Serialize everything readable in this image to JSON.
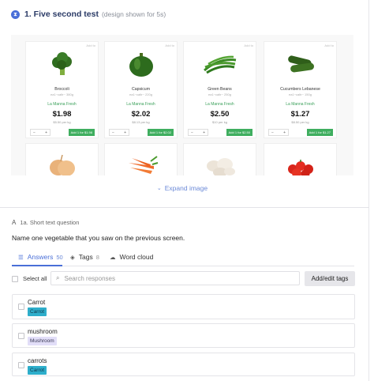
{
  "header": {
    "icon": "hourglass-icon",
    "title": "1. Five second test",
    "subtitle": "(design shown for 5s)"
  },
  "preview": {
    "products": [
      {
        "name": "Broccoli",
        "sub": "ea1~caltr~ 380g",
        "brand": "La Manna Fresh",
        "price": "$1.98",
        "unit": "$5.50 per kg",
        "add": "Add 1 for $1.98",
        "tag": "Add to"
      },
      {
        "name": "Capsicum",
        "sub": "ea1~caltr~ 220g",
        "brand": "La Manna Fresh",
        "price": "$2.02",
        "unit": "$8.13 per kg",
        "add": "Add 1 for $2.02",
        "tag": "Add to"
      },
      {
        "name": "Green Beans",
        "sub": "ea1~caltr~ 250g",
        "brand": "La Manna Fresh",
        "price": "$2.50",
        "unit": "$10 per kg",
        "add": "Add 1 for $2.50",
        "tag": "Add to"
      },
      {
        "name": "Cucumbers Lebanese",
        "sub": "ea1~caltr~ 150g",
        "brand": "La Manna Fresh",
        "price": "$1.27",
        "unit": "$8.50 per kg",
        "add": "Add 1 for $1.27",
        "tag": "Add to"
      }
    ],
    "expand_label": "Expand image"
  },
  "question": {
    "label": "1a. Short text question",
    "text": "Name one vegetable that you saw on the previous screen."
  },
  "tabs": [
    {
      "label": "Answers",
      "count": "50"
    },
    {
      "label": "Tags",
      "count": "8"
    },
    {
      "label": "Word cloud",
      "count": ""
    }
  ],
  "toolbar": {
    "select_all": "Select all",
    "search_placeholder": "Search responses",
    "add_edit_tags": "Add/edit tags"
  },
  "responses": [
    {
      "text": "Carrot",
      "tag": "Carrot"
    },
    {
      "text": "mushroom",
      "tag": "Mushroom"
    },
    {
      "text": "carrots",
      "tag": "Carrot"
    }
  ],
  "colors": {
    "accent": "#4a6fd8",
    "carrot_tag": "#2eaecb",
    "mushroom_tag": "#e2def8",
    "add_button": "#3fae5f"
  }
}
